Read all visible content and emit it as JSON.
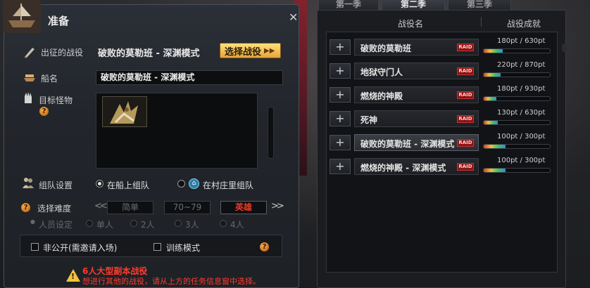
{
  "dialog": {
    "title": "准备",
    "close": "✕",
    "mission_label": "出征的战役",
    "mission_name": "破败的莫勒班 - 深渊模式",
    "select_button": "选择战役",
    "ship_label": "船名",
    "ship_name": "破败的莫勒班 - 深渊模式",
    "target_label": "目标怪物",
    "party_label": "组队设置",
    "party_options": [
      "在船上组队",
      "在村庄里组队"
    ],
    "difficulty_label": "选择难度",
    "difficulty": {
      "easy": "简单",
      "level": "70~79",
      "hard": "英雄"
    },
    "member_label": "人员设定",
    "member_options": [
      "单人",
      "2人",
      "3人",
      "4人"
    ],
    "private_option": "非公开(需邀请入场)",
    "training_option": "训练模式",
    "warning_title": "6人大型副本战役",
    "warning_text": "想进行其他的战役，请从上方的任务信息窗中选择。"
  },
  "seasons": {
    "tabs": [
      "第一季",
      "第二季",
      "第三季"
    ],
    "active_tab": 1,
    "col_name": "战役名",
    "col_score": "战役成就",
    "tag": "RAID",
    "raids": [
      {
        "name": "破败的莫勒班",
        "score": "180pt / 630pt",
        "progress": 0.286
      },
      {
        "name": "地狱守门人",
        "score": "220pt / 870pt",
        "progress": 0.253
      },
      {
        "name": "燃烧的神殿",
        "score": "180pt / 930pt",
        "progress": 0.194
      },
      {
        "name": "死神",
        "score": "130pt / 630pt",
        "progress": 0.206
      },
      {
        "name": "破败的莫勒班 - 深渊模式",
        "score": "100pt / 300pt",
        "progress": 0.333,
        "selected": true
      },
      {
        "name": "燃烧的神殿 - 深渊模式",
        "score": "100pt / 300pt",
        "progress": 0.333
      }
    ]
  },
  "colors": {
    "accent": "#f2b54a",
    "hard_difficulty": "#e63a2a",
    "warning": "#ff3b2e",
    "raid_tag": "#8b1414"
  }
}
